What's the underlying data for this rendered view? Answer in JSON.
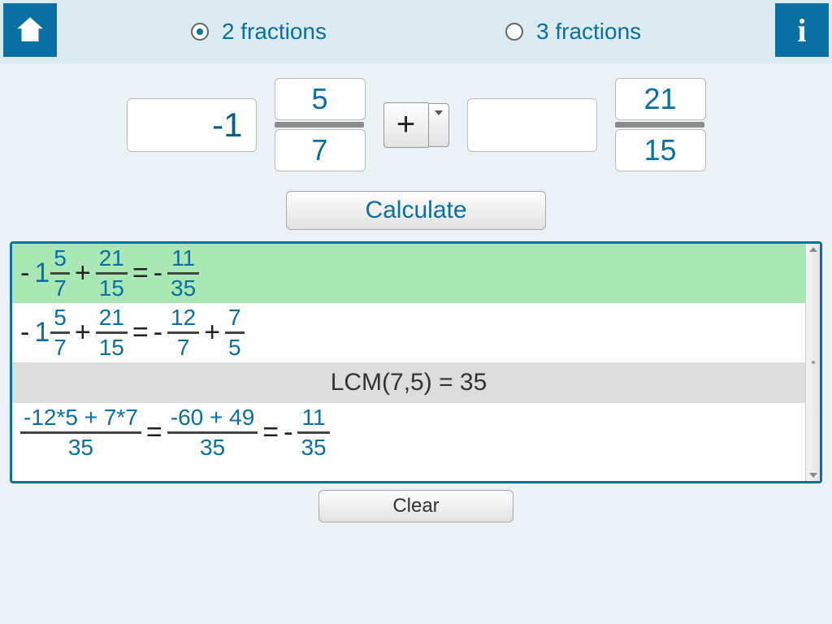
{
  "modes": {
    "two": "2 fractions",
    "three": "3 fractions",
    "selected": "two"
  },
  "input": {
    "a_whole": "-1",
    "a_num": "5",
    "a_den": "7",
    "op": "+",
    "b_whole": "",
    "b_num": "21",
    "b_den": "15"
  },
  "buttons": {
    "calculate": "Calculate",
    "clear": "Clear"
  },
  "result": {
    "line1": {
      "sign1": "-",
      "w1": "1",
      "n1": "5",
      "d1": "7",
      "op": "+",
      "n2": "21",
      "d2": "15",
      "eq": "=",
      "sign2": "-",
      "rn": "11",
      "rd": "35"
    },
    "line2": {
      "sign1": "-",
      "w1": "1",
      "n1": "5",
      "d1": "7",
      "op": "+",
      "n2": "21",
      "d2": "15",
      "eq": "=",
      "sign2": "-",
      "r1n": "12",
      "r1d": "7",
      "op2": "+",
      "r2n": "7",
      "r2d": "5"
    },
    "lcm": "LCM(7,5) = 35",
    "line3": {
      "f1n": "-12*5 + 7*7",
      "f1d": "35",
      "eq1": "=",
      "f2n": "-60 + 49",
      "f2d": "35",
      "eq2": "=",
      "sign": "-",
      "rn": "11",
      "rd": "35"
    }
  }
}
